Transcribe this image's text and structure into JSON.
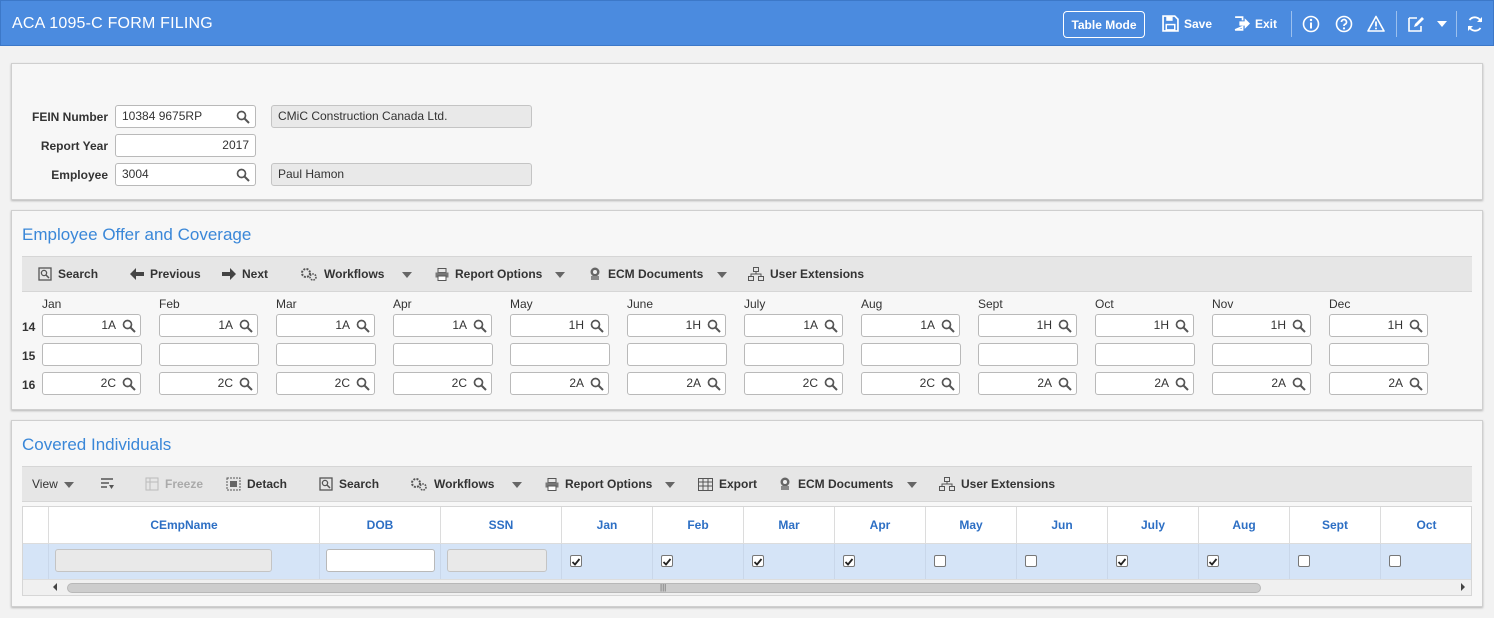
{
  "header": {
    "title": "ACA 1095-C FORM FILING",
    "table_mode": "Table Mode",
    "save": "Save",
    "exit": "Exit"
  },
  "form": {
    "fein_label": "FEIN Number",
    "fein_value": "10384 9675RP",
    "company_name": "CMiC Construction Canada Ltd.",
    "year_label": "Report Year",
    "year_value": "2017",
    "employee_label": "Employee",
    "employee_value": "3004",
    "employee_name": "Paul Hamon"
  },
  "offer": {
    "title": "Employee Offer and Coverage",
    "toolbar": [
      "Search",
      "Previous",
      "Next",
      "Workflows",
      "Report Options",
      "ECM Documents",
      "User Extensions"
    ],
    "months": [
      "Jan",
      "Feb",
      "Mar",
      "Apr",
      "May",
      "June",
      "July",
      "Aug",
      "Sept",
      "Oct",
      "Nov",
      "Dec"
    ],
    "rows": [
      {
        "label": "14",
        "values": [
          "1A",
          "1A",
          "1A",
          "1A",
          "1H",
          "1H",
          "1A",
          "1A",
          "1H",
          "1H",
          "1H",
          "1H"
        ]
      },
      {
        "label": "15",
        "values": [
          "",
          "",
          "",
          "",
          "",
          "",
          "",
          "",
          "",
          "",
          "",
          ""
        ]
      },
      {
        "label": "16",
        "values": [
          "2C",
          "2C",
          "2C",
          "2C",
          "2A",
          "2A",
          "2C",
          "2C",
          "2A",
          "2A",
          "2A",
          "2A"
        ]
      }
    ]
  },
  "covered": {
    "title": "Covered Individuals",
    "toolbar": {
      "view": "View",
      "freeze": "Freeze",
      "detach": "Detach",
      "search": "Search",
      "workflows": "Workflows",
      "report_options": "Report Options",
      "export": "Export",
      "ecm": "ECM Documents",
      "user_ext": "User Extensions"
    },
    "columns": [
      "CEmpName",
      "DOB",
      "SSN",
      "Jan",
      "Feb",
      "Mar",
      "Apr",
      "May",
      "Jun",
      "July",
      "Aug",
      "Sept",
      "Oct"
    ],
    "row_checks": [
      true,
      true,
      true,
      true,
      false,
      false,
      true,
      true,
      false,
      false
    ]
  }
}
